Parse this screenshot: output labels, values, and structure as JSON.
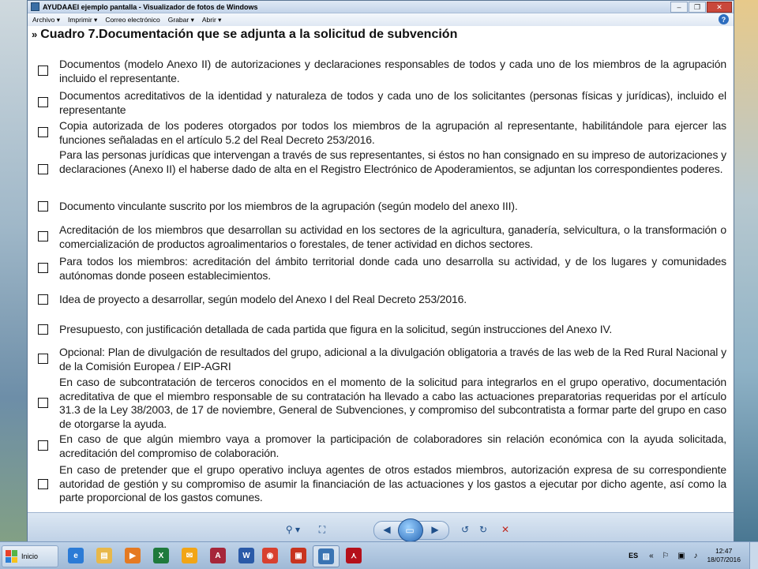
{
  "window": {
    "title": "AYUDAAEI ejemplo pantalla - Visualizador de fotos de Windows",
    "controls": [
      "–",
      "❐",
      "✕"
    ]
  },
  "menu": {
    "items": [
      "Archivo ▾",
      "Imprimir ▾",
      "Correo electrónico",
      "Grabar ▾",
      "Abrir ▾"
    ],
    "help": "?"
  },
  "document": {
    "title": "Cuadro 7.Documentación que se adjunta a la solicitud de subvención",
    "title_marker": "»",
    "items": [
      {
        "text": "Documentos (modelo Anexo II) de autorizaciones y declaraciones responsables de todos y cada uno de los miembros de la agrupación incluido el representante."
      },
      {
        "text": "Documentos acreditativos de la identidad y naturaleza de todos y cada uno de los solicitantes (personas físicas y jurídicas), incluido el representante"
      },
      {
        "text": "Copia autorizada de los poderes otorgados por todos los miembros de la agrupación al representante, habilitándole para ejercer las funciones señaladas en el artículo 5.2 del Real Decreto 253/2016."
      },
      {
        "text": "Para las personas jurídicas que intervengan a través de sus representantes, si éstos no han consignado en su impreso de autorizaciones y declaraciones (Anexo II) el haberse dado de alta en el Registro Electrónico de Apoderamientos, se adjuntan los correspondientes poderes."
      },
      {
        "text": "Documento vinculante suscrito por los miembros de la agrupación (según modelo del anexo III)."
      },
      {
        "text": "Acreditación de los miembros que desarrollan su actividad en los sectores de la agricultura, ganadería, selvicultura, o la transformación o comercialización de productos agroalimentarios o forestales, de tener actividad en dichos sectores."
      },
      {
        "text": "Para todos los miembros: acreditación del ámbito territorial donde cada uno desarrolla su actividad, y de los lugares y comunidades autónomas donde poseen establecimientos."
      },
      {
        "text": "Idea de proyecto a desarrollar, según modelo del Anexo I del Real Decreto 253/2016."
      },
      {
        "text": "Presupuesto, con justificación detallada de cada partida que figura en la solicitud, según instrucciones del Anexo IV."
      },
      {
        "text": "Opcional: Plan de divulgación de resultados del grupo, adicional a la divulgación obligatoria a través de las web de la Red Rural Nacional y de la Comisión Europea / EIP-AGRI"
      },
      {
        "text": "En caso de subcontratación de terceros conocidos en el momento de la solicitud para integrarlos en el grupo operativo, documentación acreditativa de que el miembro responsable de su contratación ha llevado a cabo las actuaciones preparatorias requeridas por el artículo 31.3 de la Ley 38/2003, de 17 de noviembre, General de Subvenciones, y compromiso del subcontratista a formar parte del grupo en caso de otorgarse la ayuda."
      },
      {
        "text": "En caso de que algún miembro vaya a promover la participación de colaboradores sin relación económica con la ayuda solicitada, acreditación del compromiso de colaboración."
      },
      {
        "text": "En caso de pretender que el grupo operativo incluya agentes de otros estados miembros, autorización expresa de su correspondiente autoridad de gestión y su compromiso de asumir la financiación de las actuaciones y los gastos a ejecutar por dicho agente, así como la parte proporcional de los gastos comunes."
      }
    ]
  },
  "viewer_toolbar": {
    "zoom": "⚲ ▾",
    "fit": "⛶",
    "prev": "◀",
    "slideshow": "▭",
    "next": "▶",
    "rotate_left": "↺",
    "rotate_right": "↻",
    "delete": "✕"
  },
  "taskbar": {
    "start_label": "Inicio",
    "apps": [
      {
        "icon": "ie-icon",
        "glyph": "e",
        "color": "#2b7bd6"
      },
      {
        "icon": "explorer-icon",
        "glyph": "▤",
        "color": "#e8b84a"
      },
      {
        "icon": "media-player-icon",
        "glyph": "▶",
        "color": "#e57a22"
      },
      {
        "icon": "excel-icon",
        "glyph": "X",
        "color": "#1f7a3c"
      },
      {
        "icon": "outlook-icon",
        "glyph": "✉",
        "color": "#f2a516"
      },
      {
        "icon": "access-icon",
        "glyph": "A",
        "color": "#a6263a"
      },
      {
        "icon": "word-icon",
        "glyph": "W",
        "color": "#2a5aa8"
      },
      {
        "icon": "chrome-icon",
        "glyph": "◉",
        "color": "#d8402f"
      },
      {
        "icon": "acrobat-icon",
        "glyph": "▣",
        "color": "#c8341f"
      },
      {
        "icon": "photo-viewer-icon",
        "glyph": "▨",
        "color": "#3a74b3"
      },
      {
        "icon": "pdf-icon",
        "glyph": "⋏",
        "color": "#b5101a"
      }
    ],
    "language": "ES",
    "tray_icons": "« ⚐ ▣ ♪",
    "time": "12:47",
    "date": "18/07/2016"
  }
}
